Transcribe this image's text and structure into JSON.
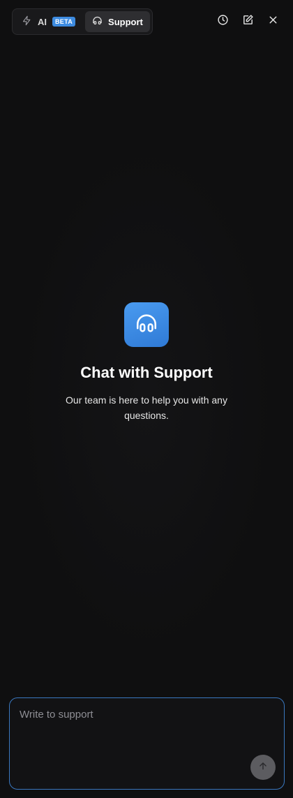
{
  "tabs": [
    {
      "label": "AI",
      "badge": "BETA",
      "icon": "lightning-icon"
    },
    {
      "label": "Support",
      "icon": "headphones-icon",
      "active": true
    }
  ],
  "actions": [
    {
      "name": "history-icon"
    },
    {
      "name": "new-chat-icon"
    },
    {
      "name": "close-icon"
    }
  ],
  "hero": {
    "icon": "headphones-icon",
    "title": "Chat with Support",
    "subtitle": "Our team is here to help you with any questions."
  },
  "composer": {
    "placeholder": "Write to support",
    "value": ""
  },
  "colors": {
    "accent": "#3d8be0",
    "background": "#0f0f10"
  }
}
